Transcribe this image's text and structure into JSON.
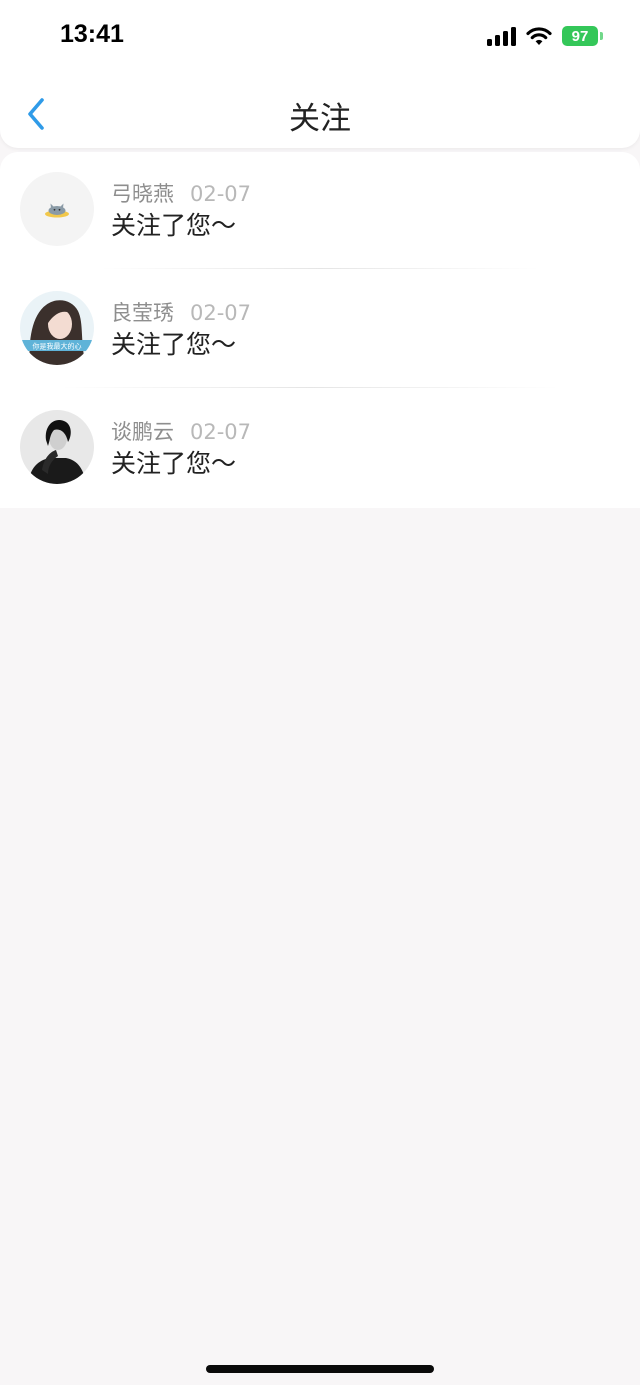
{
  "status_bar": {
    "time": "13:41",
    "battery": "97"
  },
  "header": {
    "title": "关注"
  },
  "notifications": [
    {
      "name": "弓晓燕",
      "date": "02-07",
      "message": "关注了您～"
    },
    {
      "name": "良莹琇",
      "date": "02-07",
      "message": "关注了您～",
      "avatar_caption": "你是我最大的心"
    },
    {
      "name": "谈鹏云",
      "date": "02-07",
      "message": "关注了您～"
    }
  ],
  "colors": {
    "accent": "#2f9be8",
    "battery": "#34c759",
    "background": "#f8f6f7"
  }
}
